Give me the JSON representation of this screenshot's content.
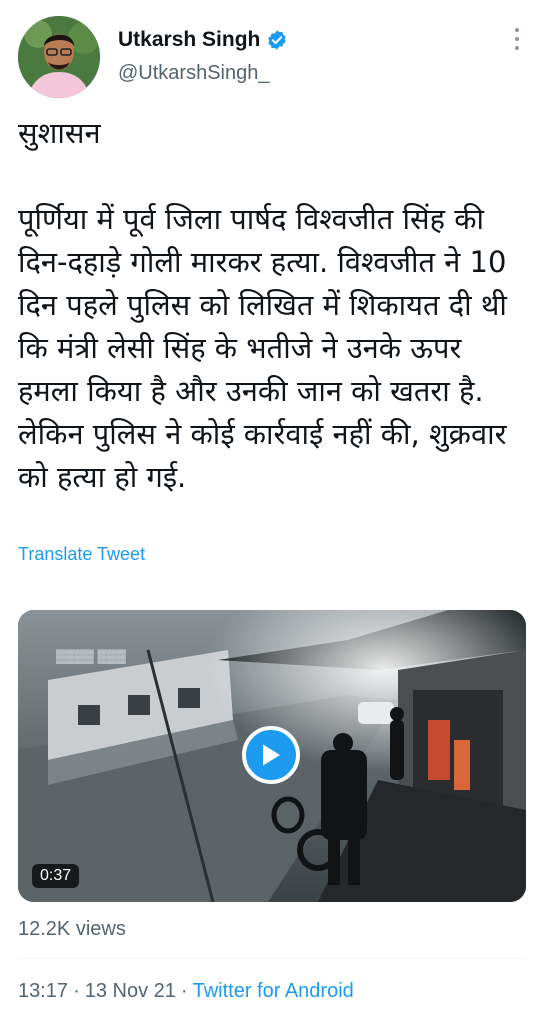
{
  "author": {
    "name": "Utkarsh Singh",
    "handle": "@UtkarshSingh_",
    "verified": true,
    "avatar_icon": "profile-photo"
  },
  "tweet": {
    "text": "सुशासन\n\nपूर्णिया में पूर्व जिला पार्षद विश्वजीत सिंह की दिन-दहाड़े गोली मारकर हत्या. विश्वजीत ने 10 दिन पहले पुलिस को लिखित में शिकायत दी थी कि मंत्री लेसी सिंह के भतीजे ने उनके ऊपर हमला किया है और उनकी जान को खतरा है. लेकिन पुलिस ने कोई कार्रवाई नहीं की, शुक्रवार को हत्या हो गई.",
    "translate_label": "Translate Tweet"
  },
  "media": {
    "type": "video",
    "duration": "0:37",
    "play_icon": "play-icon"
  },
  "stats": {
    "views": "12.2K views"
  },
  "meta": {
    "time": "13:17",
    "separator": "·",
    "date": "13 Nov 21",
    "source": "Twitter for Android"
  },
  "colors": {
    "accent": "#1d9bf0",
    "secondary_text": "#536471"
  }
}
